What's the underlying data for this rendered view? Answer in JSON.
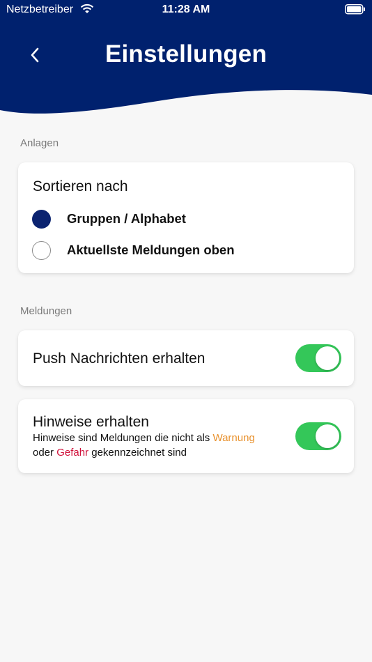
{
  "status_bar": {
    "carrier": "Netzbetreiber",
    "time": "11:28 AM",
    "wifi_icon": "wifi-icon",
    "battery_icon": "battery-icon"
  },
  "header": {
    "title": "Einstellungen",
    "back_icon": "chevron-left-icon",
    "background_color": "#00216e"
  },
  "sections": {
    "anlagen": {
      "label": "Anlagen",
      "sort_card": {
        "title": "Sortieren nach",
        "options": [
          {
            "label": "Gruppen / Alphabet",
            "selected": true
          },
          {
            "label": "Aktuellste Meldungen oben",
            "selected": false
          }
        ]
      }
    },
    "meldungen": {
      "label": "Meldungen",
      "push": {
        "title": "Push Nachrichten erhalten",
        "enabled": true
      },
      "hinweise": {
        "title": "Hinweise erhalten",
        "enabled": true,
        "desc_part1": "Hinweise sind Meldungen die nicht als ",
        "desc_warnung": "Warnung",
        "desc_part2": "oder ",
        "desc_gefahr": "Gefahr",
        "desc_part3": " gekennzeichnet sind"
      }
    }
  },
  "colors": {
    "selected_radio": "#0b2370",
    "toggle_on": "#34c759",
    "warnung": "#e8912d",
    "gefahr": "#d0103a"
  }
}
